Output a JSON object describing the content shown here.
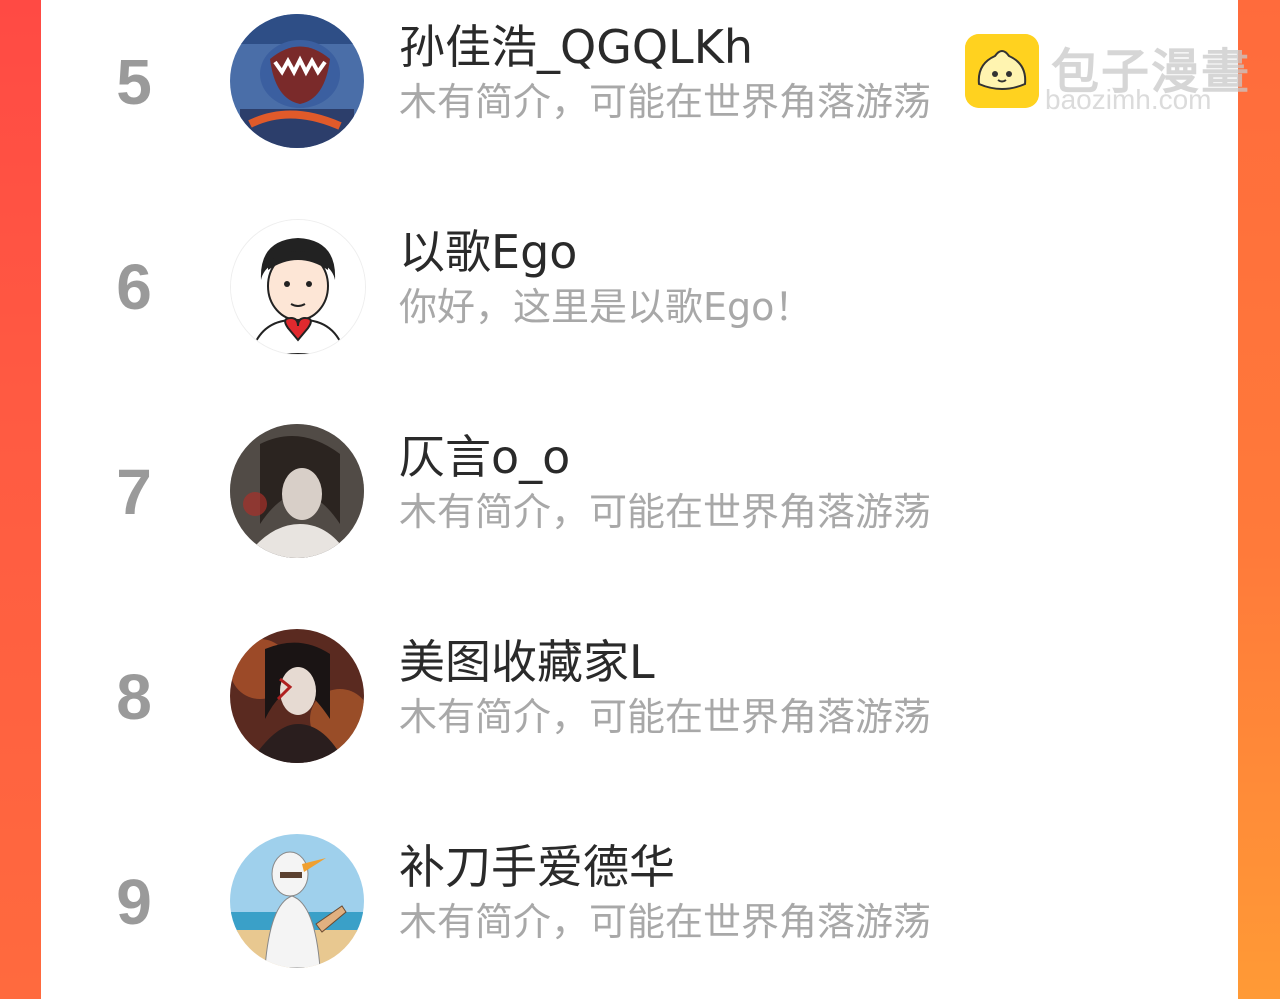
{
  "watermark": {
    "title": "包子漫畫",
    "url": "baozimh.com",
    "logo_icon": "bun-icon"
  },
  "ranking": [
    {
      "rank": "5",
      "name": "孙佳浩_QGQLKh",
      "bio": "木有简介，可能在世界角落游荡",
      "avatar_icon": "cartoon-creature-avatar"
    },
    {
      "rank": "6",
      "name": "以歌Ego",
      "bio": "你好，这里是以歌Ego！",
      "avatar_icon": "cartoon-boy-heart-avatar"
    },
    {
      "rank": "7",
      "name": "仄言o_o",
      "bio": "木有简介，可能在世界角落游荡",
      "avatar_icon": "illustrated-portrait-avatar"
    },
    {
      "rank": "8",
      "name": "美图收藏家L",
      "bio": "木有简介，可能在世界角落游荡",
      "avatar_icon": "illustrated-dark-portrait-avatar"
    },
    {
      "rank": "9",
      "name": "补刀手爱德华",
      "bio": "木有简介，可能在世界角落游荡",
      "avatar_icon": "cartoon-bird-pointing-avatar"
    }
  ],
  "colors": {
    "background_accent": "#ff4a44",
    "rank_text": "#9a9a9a",
    "name_text": "#2a2a2a",
    "bio_text": "#a8a8a8",
    "logo_yellow": "#ffd21f"
  }
}
